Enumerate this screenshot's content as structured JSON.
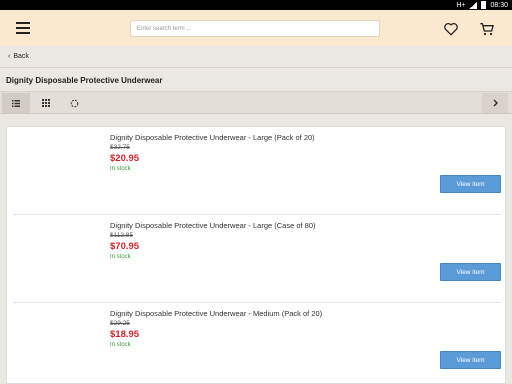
{
  "status": {
    "network": "H+",
    "time": "08:30"
  },
  "header": {
    "search_placeholder": "Enter search term ..."
  },
  "nav": {
    "back_label": "Back"
  },
  "page": {
    "title": "Dignity Disposable Protective Underwear"
  },
  "products": [
    {
      "name": "Dignity Disposable Protective Underwear - Large (Pack of 20)",
      "old_price": "$32.75",
      "price": "$20.95",
      "stock": "In stock",
      "button": "View item"
    },
    {
      "name": "Dignity Disposable Protective Underwear - Large (Case of 80)",
      "old_price": "$112.85",
      "price": "$70.95",
      "stock": "In stock",
      "button": "View item"
    },
    {
      "name": "Dignity Disposable Protective Underwear - Medium (Pack of 20)",
      "old_price": "$29.25",
      "price": "$18.95",
      "stock": "In stock",
      "button": "View item"
    }
  ]
}
